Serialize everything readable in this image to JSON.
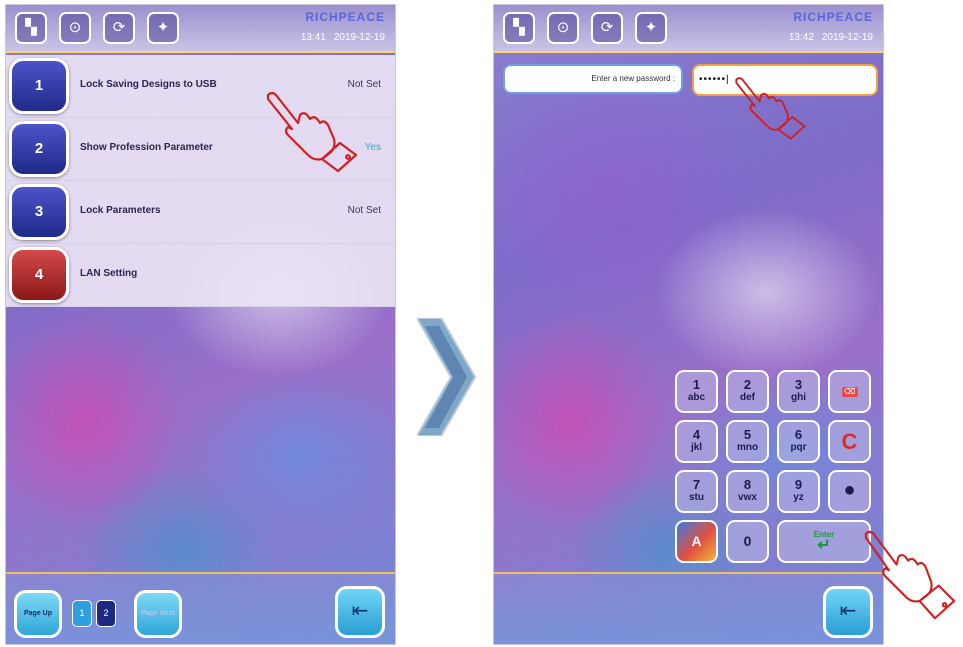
{
  "left_screen": {
    "topbar": {
      "icons": [
        "layout-icon",
        "usb-icon",
        "refresh-icon",
        "lightbulb-icon"
      ],
      "brand": [
        "RICHPEACE",
        ""
      ],
      "time": "13:41",
      "date": "2019-12-19"
    },
    "menu": [
      {
        "num": "1",
        "label": "Lock Saving Designs to USB",
        "value": "Not Set",
        "color": "#2a3499"
      },
      {
        "num": "2",
        "label": "Show Profession Parameter",
        "value": "Yes",
        "color": "#2a3499"
      },
      {
        "num": "3",
        "label": "Lock Parameters",
        "value": "Not Set",
        "color": "#2a3499"
      },
      {
        "num": "4",
        "label": "LAN Setting",
        "value": "",
        "color": "#a82020"
      }
    ],
    "bottombar": {
      "page_up": "Page Up",
      "pages": [
        "1",
        "2"
      ],
      "page_next": "Page Next",
      "exit_icon": "exit-icon"
    }
  },
  "right_screen": {
    "topbar": {
      "icons": [
        "layout-icon",
        "usb-icon",
        "refresh-icon",
        "lightbulb-icon"
      ],
      "brand": [
        "RICHPEACE",
        ""
      ],
      "time": "13:42",
      "date": "2019-12-19"
    },
    "password_label": "Enter a new password :",
    "password_value": "••••••|",
    "keypad": {
      "keys": [
        {
          "d": "1",
          "l": "abc"
        },
        {
          "d": "2",
          "l": "def"
        },
        {
          "d": "3",
          "l": "ghi"
        },
        {
          "d": "4",
          "l": "jkl"
        },
        {
          "d": "5",
          "l": "mno"
        },
        {
          "d": "6",
          "l": "pqr"
        },
        {
          "d": "7",
          "l": "stu"
        },
        {
          "d": "8",
          "l": "vwx"
        },
        {
          "d": "9",
          "l": "yz"
        }
      ],
      "backspace": "⌫",
      "clear": "C",
      "dot": "●",
      "mode": "A",
      "zero": "0",
      "enter": "Enter"
    },
    "bottombar": {
      "exit_icon": "exit-icon"
    }
  },
  "colors": {
    "accent_blue": "#2a3499",
    "accent_red": "#a82020",
    "cyan_button": "#2ea7d8",
    "hand_red": "#d02020"
  }
}
